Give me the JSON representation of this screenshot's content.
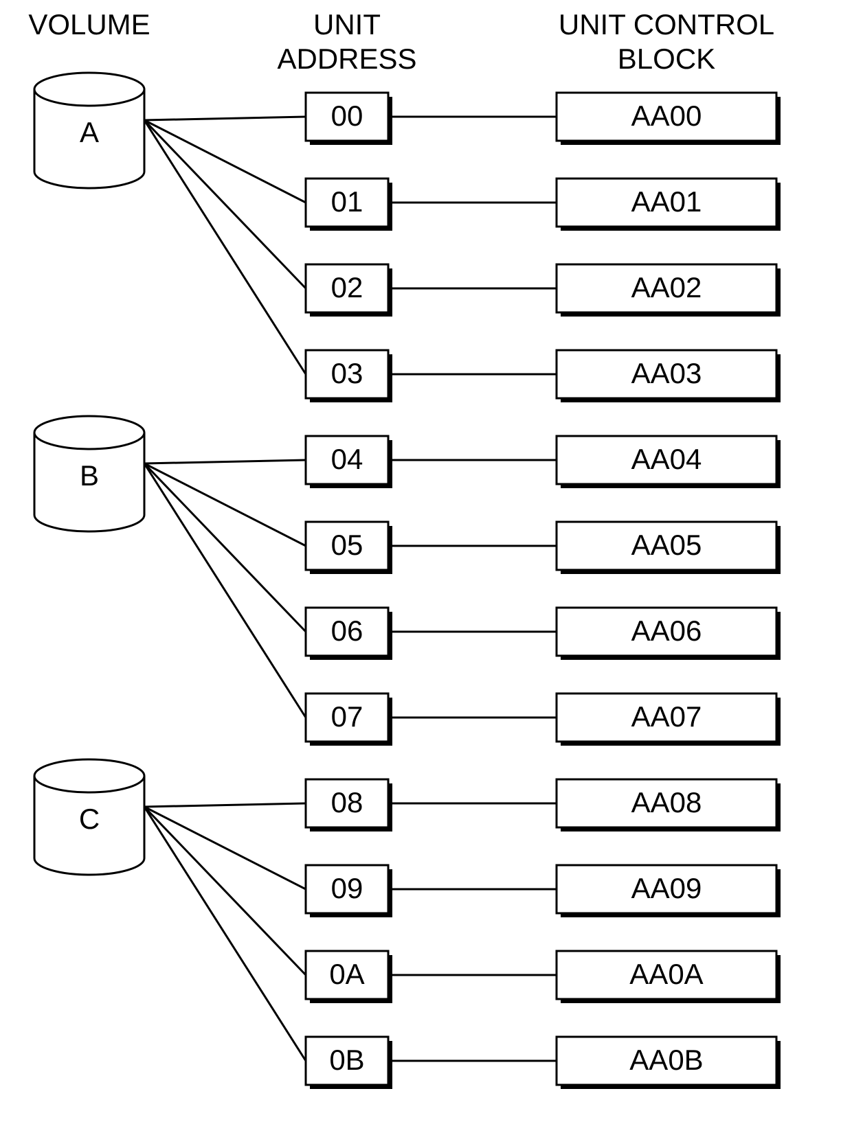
{
  "headers": {
    "volume": "VOLUME",
    "unit_address_l1": "UNIT",
    "unit_address_l2": "ADDRESS",
    "ucb_l1": "UNIT CONTROL",
    "ucb_l2": "BLOCK"
  },
  "volumes": [
    {
      "label": "A",
      "addrs": [
        "00",
        "01",
        "02",
        "03"
      ],
      "ucbs": [
        "AA00",
        "AA01",
        "AA02",
        "AA03"
      ]
    },
    {
      "label": "B",
      "addrs": [
        "04",
        "05",
        "06",
        "07"
      ],
      "ucbs": [
        "AA04",
        "AA05",
        "AA06",
        "AA07"
      ]
    },
    {
      "label": "C",
      "addrs": [
        "08",
        "09",
        "0A",
        "0B"
      ],
      "ucbs": [
        "AA08",
        "AA09",
        "AA0A",
        "AA0B"
      ]
    }
  ]
}
